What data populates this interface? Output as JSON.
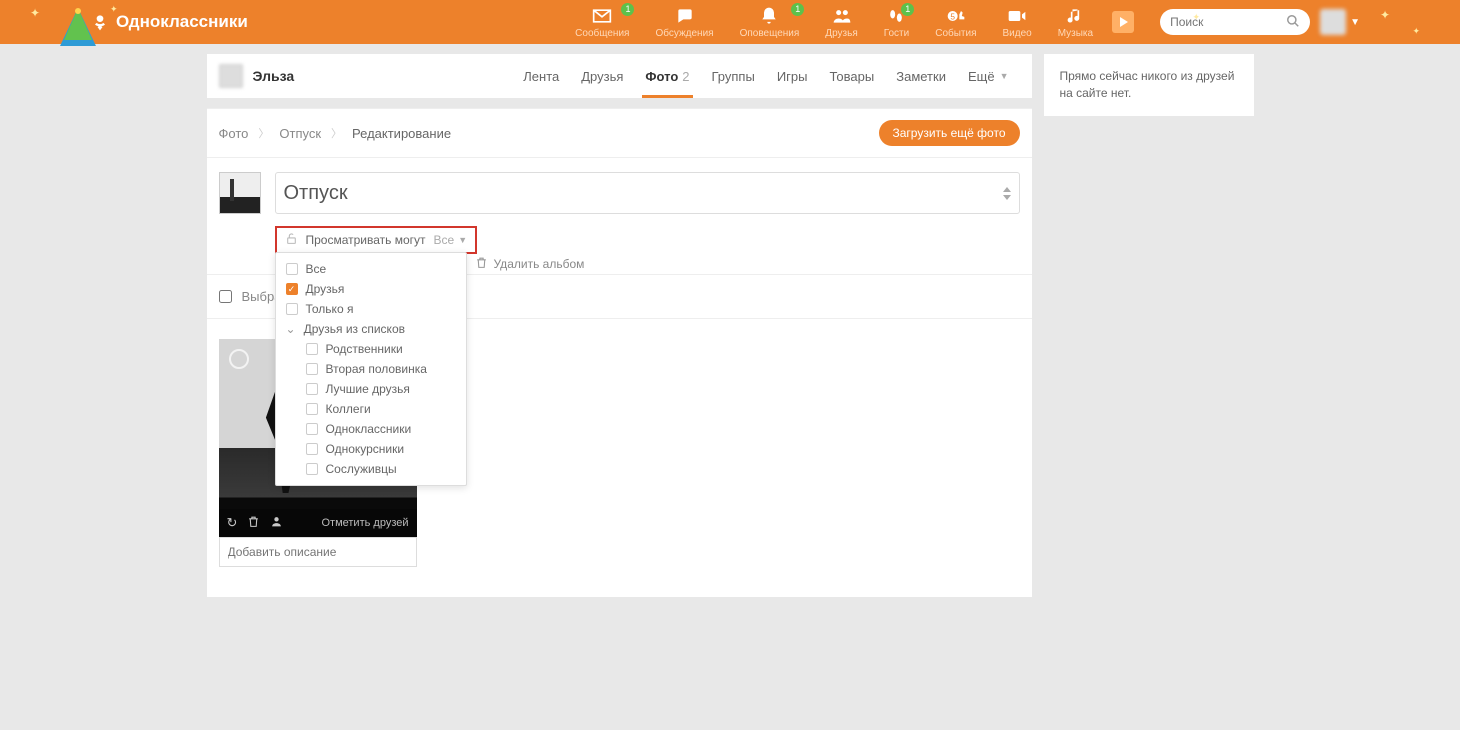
{
  "site": {
    "name": "Одноклассники"
  },
  "header_nav": [
    {
      "label": "Сообщения",
      "badge": "1"
    },
    {
      "label": "Обсуждения",
      "badge": ""
    },
    {
      "label": "Оповещения",
      "badge": "1"
    },
    {
      "label": "Друзья",
      "badge": ""
    },
    {
      "label": "Гости",
      "badge": "1"
    },
    {
      "label": "События",
      "badge": ""
    },
    {
      "label": "Видео",
      "badge": ""
    },
    {
      "label": "Музыка",
      "badge": ""
    }
  ],
  "search": {
    "placeholder": "Поиск"
  },
  "profile": {
    "name": "Эльза"
  },
  "tabs": [
    {
      "label": "Лента"
    },
    {
      "label": "Друзья"
    },
    {
      "label": "Фото",
      "count": "2",
      "active": true
    },
    {
      "label": "Группы"
    },
    {
      "label": "Игры"
    },
    {
      "label": "Товары"
    },
    {
      "label": "Заметки"
    },
    {
      "label": "Ещё"
    }
  ],
  "breadcrumbs": {
    "root": "Фото",
    "album": "Отпуск",
    "current": "Редактирование"
  },
  "upload_label": "Загрузить ещё фото",
  "album": {
    "title": "Отпуск",
    "visibility_label": "Просматривать могут",
    "visibility_value": "Все",
    "delete_label": "Удалить альбом"
  },
  "visibility_options": {
    "top": [
      {
        "label": "Все",
        "checked": false
      },
      {
        "label": "Друзья",
        "checked": true
      },
      {
        "label": "Только я",
        "checked": false
      }
    ],
    "group_label": "Друзья из списков",
    "sub": [
      {
        "label": "Родственники",
        "checked": false
      },
      {
        "label": "Вторая половинка",
        "checked": false
      },
      {
        "label": "Лучшие друзья",
        "checked": false
      },
      {
        "label": "Коллеги",
        "checked": false
      },
      {
        "label": "Одноклассники",
        "checked": false
      },
      {
        "label": "Однокурсники",
        "checked": false
      },
      {
        "label": "Сослуживцы",
        "checked": false
      }
    ]
  },
  "select_all_label": "Выбрать все",
  "photo": {
    "tag_label": "Отметить друзей",
    "caption_placeholder": "Добавить описание"
  },
  "side_notice": "Прямо сейчас никого из друзей на сайте нет."
}
